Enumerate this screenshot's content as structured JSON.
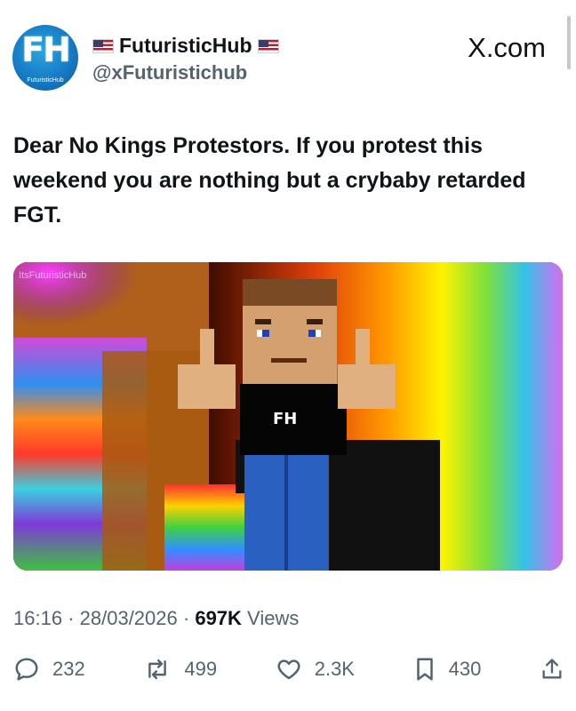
{
  "author": {
    "display_name": "FuturisticHub",
    "handle": "@xFuturistichub",
    "avatar_letters": "FH",
    "avatar_subtitle": "FuturisticHub",
    "flag_icon": "us-flag-icon"
  },
  "brand": {
    "site_label": "X.com"
  },
  "tweet": {
    "text": "Dear No Kings Protestors. If you protest this weekend you are nothing but a crybaby retarded FGT.",
    "media_watermark": "ItsFuturisticHub",
    "media_shirt_text": "FH"
  },
  "meta": {
    "time": "16:16",
    "separator": "·",
    "date": "28/03/2026",
    "views_count": "697K",
    "views_label": "Views"
  },
  "actions": {
    "replies": "232",
    "reposts": "499",
    "likes": "2.3K",
    "bookmarks": "430",
    "icons": [
      "reply-icon",
      "repost-icon",
      "like-icon",
      "bookmark-icon",
      "share-icon"
    ]
  },
  "colors": {
    "text": "#0f1419",
    "secondary": "#536471",
    "avatar_blue": "#1577c2"
  }
}
